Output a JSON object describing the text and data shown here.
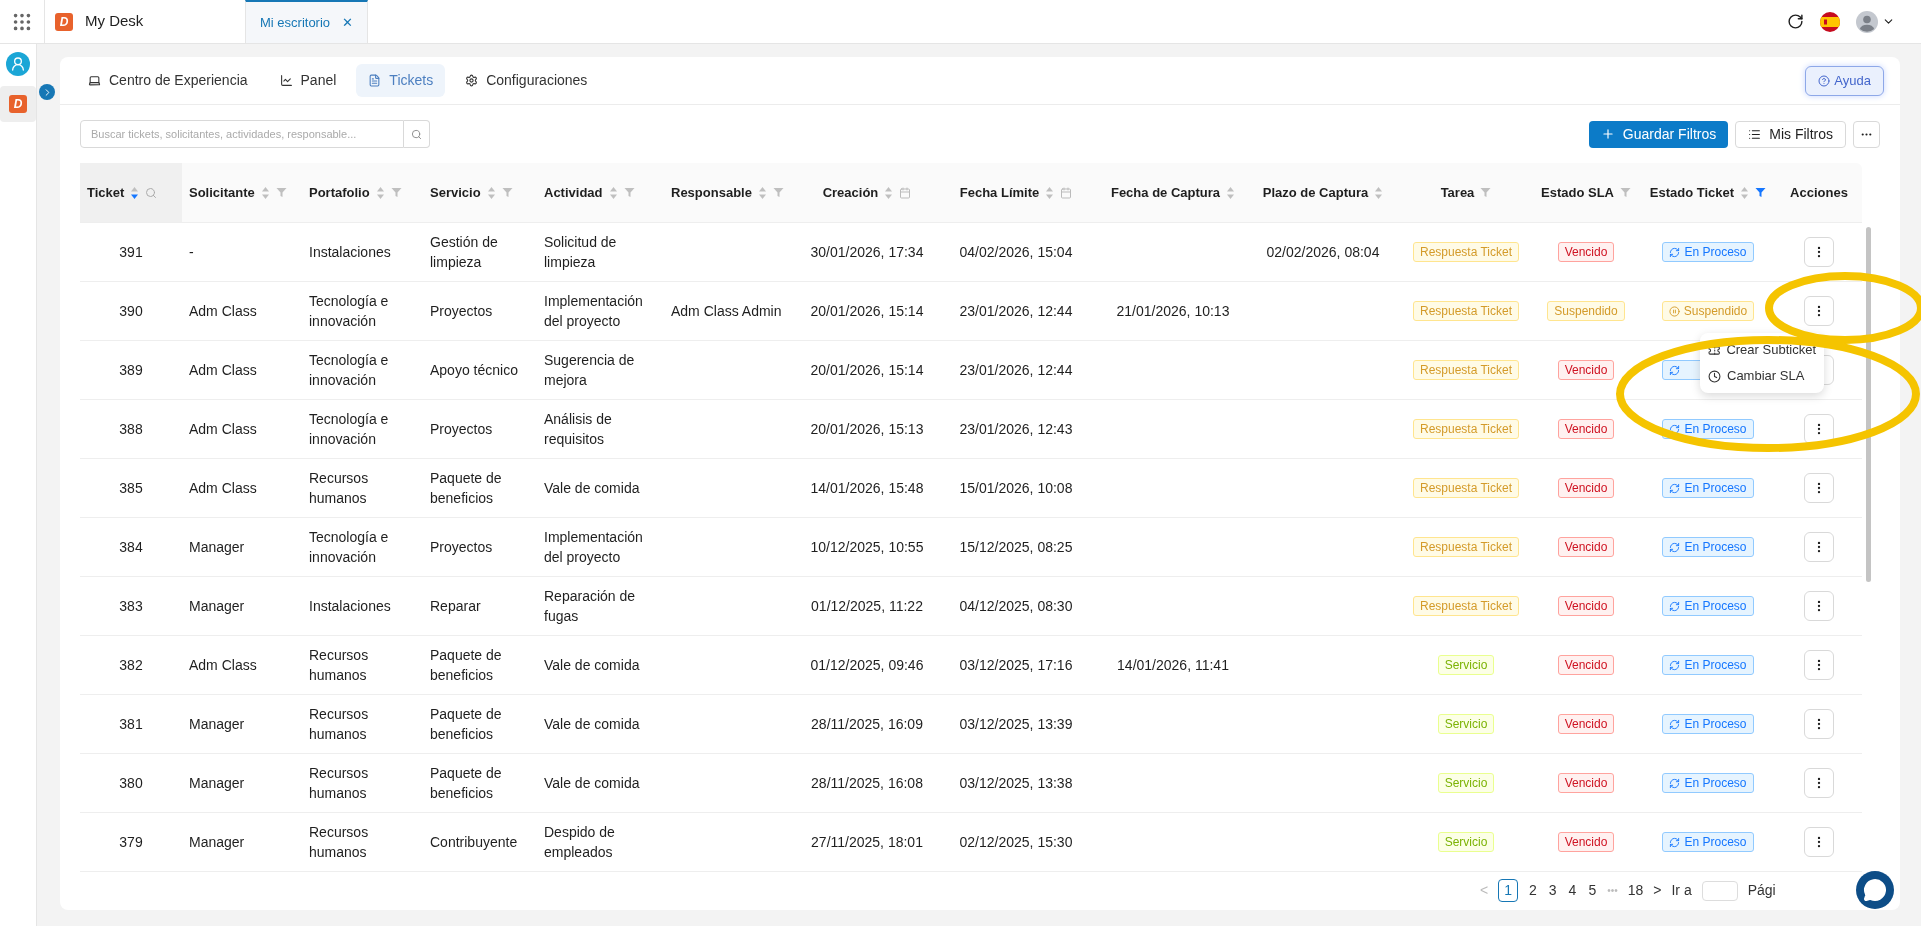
{
  "app": {
    "logo": "D",
    "title": "My Desk"
  },
  "window_tabs": [
    {
      "label": "Mi escritorio",
      "selected": true,
      "close": "✕"
    }
  ],
  "rail": {
    "logo": "D"
  },
  "nav_tabs": [
    {
      "label": "Centro de Experiencia",
      "kind": "laptop",
      "selected": false
    },
    {
      "label": "Panel",
      "kind": "chart",
      "selected": false
    },
    {
      "label": "Tickets",
      "kind": "list",
      "selected": true
    },
    {
      "label": "Configuraciones",
      "kind": "gear",
      "selected": false
    }
  ],
  "help_button": "Ayuda",
  "search": {
    "placeholder": "Buscar tickets, solicitantes, actividades, responsable..."
  },
  "toolbar": {
    "save": "Guardar Filtros",
    "mine": "Mis Filtros"
  },
  "columns": [
    {
      "label": "Ticket",
      "sortable": true,
      "sorted": true,
      "search": true,
      "filter": false,
      "calendar": false
    },
    {
      "label": "Solicitante",
      "sortable": true,
      "sorted": false,
      "search": false,
      "filter": true,
      "filter_active": false,
      "calendar": false
    },
    {
      "label": "Portafolio",
      "sortable": true,
      "sorted": false,
      "search": false,
      "filter": true,
      "filter_active": false,
      "calendar": false
    },
    {
      "label": "Servicio",
      "sortable": true,
      "sorted": false,
      "search": false,
      "filter": true,
      "filter_active": false,
      "calendar": false
    },
    {
      "label": "Actividad",
      "sortable": true,
      "sorted": false,
      "search": false,
      "filter": true,
      "filter_active": false,
      "calendar": false
    },
    {
      "label": "Responsable",
      "sortable": true,
      "sorted": false,
      "search": false,
      "filter": true,
      "filter_active": false,
      "calendar": false
    },
    {
      "label": "Creación",
      "sortable": true,
      "sorted": false,
      "search": false,
      "filter": false,
      "calendar": true
    },
    {
      "label": "Fecha Límite",
      "sortable": true,
      "sorted": false,
      "search": false,
      "filter": false,
      "calendar": true
    },
    {
      "label": "Fecha de Captura",
      "sortable": true,
      "sorted": false,
      "search": false,
      "filter": false,
      "calendar": false
    },
    {
      "label": "Plazo de Captura",
      "sortable": true,
      "sorted": false,
      "search": false,
      "filter": false,
      "calendar": false
    },
    {
      "label": "Tarea",
      "sortable": false,
      "search": false,
      "filter": true,
      "filter_active": false,
      "calendar": false
    },
    {
      "label": "Estado SLA",
      "sortable": false,
      "search": false,
      "filter": true,
      "filter_active": false,
      "calendar": false
    },
    {
      "label": "Estado Ticket",
      "sortable": true,
      "sorted": false,
      "search": false,
      "filter": true,
      "filter_active": true,
      "calendar": false
    },
    {
      "label": "Acciones",
      "sortable": false,
      "search": false,
      "filter": false,
      "calendar": false
    }
  ],
  "rows": [
    {
      "ticket": "391",
      "solicitante": "-",
      "portafolio": "Instalaciones",
      "servicio": "Gestión de limpieza",
      "actividad": "Solicitud de limpieza",
      "creacion": "30/01/2026, 17:34",
      "limite": "04/02/2026, 15:04",
      "plazo": "02/02/2026, 08:04",
      "tarea": {
        "label": "Respuesta Ticket",
        "kind": "respuesta"
      },
      "sla": {
        "label": "Vencido",
        "kind": "vencido"
      },
      "estado": {
        "label": "En Proceso",
        "kind": "proceso"
      }
    },
    {
      "ticket": "390",
      "solicitante": "Adm Class",
      "portafolio": "Tecnología e innovación",
      "servicio": "Proyectos",
      "actividad": "Implementación del proyecto",
      "responsable": "Adm Class Admin",
      "creacion": "20/01/2026, 15:14",
      "limite": "23/01/2026, 12:44",
      "captura": "21/01/2026, 10:13",
      "tarea": {
        "label": "Respuesta Ticket",
        "kind": "respuesta"
      },
      "sla": {
        "label": "Suspendido",
        "kind": "suspendido"
      },
      "estado": {
        "label": "Suspendido",
        "kind": "suspendido"
      }
    },
    {
      "ticket": "389",
      "solicitante": "Adm Class",
      "portafolio": "Tecnología e innovación",
      "servicio": "Apoyo técnico",
      "actividad": "Sugerencia de mejora",
      "creacion": "20/01/2026, 15:14",
      "limite": "23/01/2026, 12:44",
      "tarea": {
        "label": "Respuesta Ticket",
        "kind": "respuesta"
      },
      "sla": {
        "label": "Vencido",
        "kind": "vencido"
      },
      "estado": {
        "kind": "proceso"
      }
    },
    {
      "ticket": "388",
      "solicitante": "Adm Class",
      "portafolio": "Tecnología e innovación",
      "servicio": "Proyectos",
      "actividad": "Análisis de requisitos",
      "creacion": "20/01/2026, 15:13",
      "limite": "23/01/2026, 12:43",
      "tarea": {
        "label": "Respuesta Ticket",
        "kind": "respuesta"
      },
      "sla": {
        "label": "Vencido",
        "kind": "vencido"
      },
      "estado": {
        "label": "En Proceso",
        "kind": "proceso"
      }
    },
    {
      "ticket": "385",
      "solicitante": "Adm Class",
      "portafolio": "Recursos humanos",
      "servicio": "Paquete de beneficios",
      "actividad": "Vale de comida",
      "creacion": "14/01/2026, 15:48",
      "limite": "15/01/2026, 10:08",
      "tarea": {
        "label": "Respuesta Ticket",
        "kind": "respuesta"
      },
      "sla": {
        "label": "Vencido",
        "kind": "vencido"
      },
      "estado": {
        "label": "En Proceso",
        "kind": "proceso"
      }
    },
    {
      "ticket": "384",
      "solicitante": "Manager",
      "portafolio": "Tecnología e innovación",
      "servicio": "Proyectos",
      "actividad": "Implementación del proyecto",
      "creacion": "10/12/2025, 10:55",
      "limite": "15/12/2025, 08:25",
      "tarea": {
        "label": "Respuesta Ticket",
        "kind": "respuesta"
      },
      "sla": {
        "label": "Vencido",
        "kind": "vencido"
      },
      "estado": {
        "label": "En Proceso",
        "kind": "proceso"
      }
    },
    {
      "ticket": "383",
      "solicitante": "Manager",
      "portafolio": "Instalaciones",
      "servicio": "Reparar",
      "actividad": "Reparación de fugas",
      "creacion": "01/12/2025, 11:22",
      "limite": "04/12/2025, 08:30",
      "tarea": {
        "label": "Respuesta Ticket",
        "kind": "respuesta"
      },
      "sla": {
        "label": "Vencido",
        "kind": "vencido"
      },
      "estado": {
        "label": "En Proceso",
        "kind": "proceso"
      }
    },
    {
      "ticket": "382",
      "solicitante": "Adm Class",
      "portafolio": "Recursos humanos",
      "servicio": "Paquete de beneficios",
      "actividad": "Vale de comida",
      "creacion": "01/12/2025, 09:46",
      "limite": "03/12/2025, 17:16",
      "captura": "14/01/2026, 11:41",
      "tarea": {
        "label": "Servicio",
        "kind": "servicio"
      },
      "sla": {
        "label": "Vencido",
        "kind": "vencido"
      },
      "estado": {
        "label": "En Proceso",
        "kind": "proceso"
      }
    },
    {
      "ticket": "381",
      "solicitante": "Manager",
      "portafolio": "Recursos humanos",
      "servicio": "Paquete de beneficios",
      "actividad": "Vale de comida",
      "creacion": "28/11/2025, 16:09",
      "limite": "03/12/2025, 13:39",
      "tarea": {
        "label": "Servicio",
        "kind": "servicio"
      },
      "sla": {
        "label": "Vencido",
        "kind": "vencido"
      },
      "estado": {
        "label": "En Proceso",
        "kind": "proceso"
      }
    },
    {
      "ticket": "380",
      "solicitante": "Manager",
      "portafolio": "Recursos humanos",
      "servicio": "Paquete de beneficios",
      "actividad": "Vale de comida",
      "creacion": "28/11/2025, 16:08",
      "limite": "03/12/2025, 13:38",
      "tarea": {
        "label": "Servicio",
        "kind": "servicio"
      },
      "sla": {
        "label": "Vencido",
        "kind": "vencido"
      },
      "estado": {
        "label": "En Proceso",
        "kind": "proceso"
      }
    },
    {
      "ticket": "379",
      "solicitante": "Manager",
      "portafolio": "Recursos humanos",
      "servicio": "Contribuyente",
      "actividad": "Despido de empleados",
      "creacion": "27/11/2025, 18:01",
      "limite": "02/12/2025, 15:30",
      "tarea": {
        "label": "Servicio",
        "kind": "servicio"
      },
      "sla": {
        "label": "Vencido",
        "kind": "vencido"
      },
      "estado": {
        "label": "En Proceso",
        "kind": "proceso"
      }
    }
  ],
  "action_menu": [
    {
      "label": "Crear Subticket",
      "kind": "ticket"
    },
    {
      "label": "Cambiar SLA",
      "kind": "clock"
    }
  ],
  "pagination": {
    "prev": "<",
    "pages": [
      {
        "label": "1",
        "selected": true
      },
      {
        "label": "2",
        "selected": false
      },
      {
        "label": "3",
        "selected": false
      },
      {
        "label": "4",
        "selected": false
      },
      {
        "label": "5",
        "selected": false
      }
    ],
    "ellipsis": "•••",
    "last": "18",
    "next": ">",
    "goto": "Ir a",
    "page_label": "Pági"
  },
  "annotations": [
    {
      "kind": "ellipse"
    },
    {
      "kind": "ellipse"
    }
  ]
}
